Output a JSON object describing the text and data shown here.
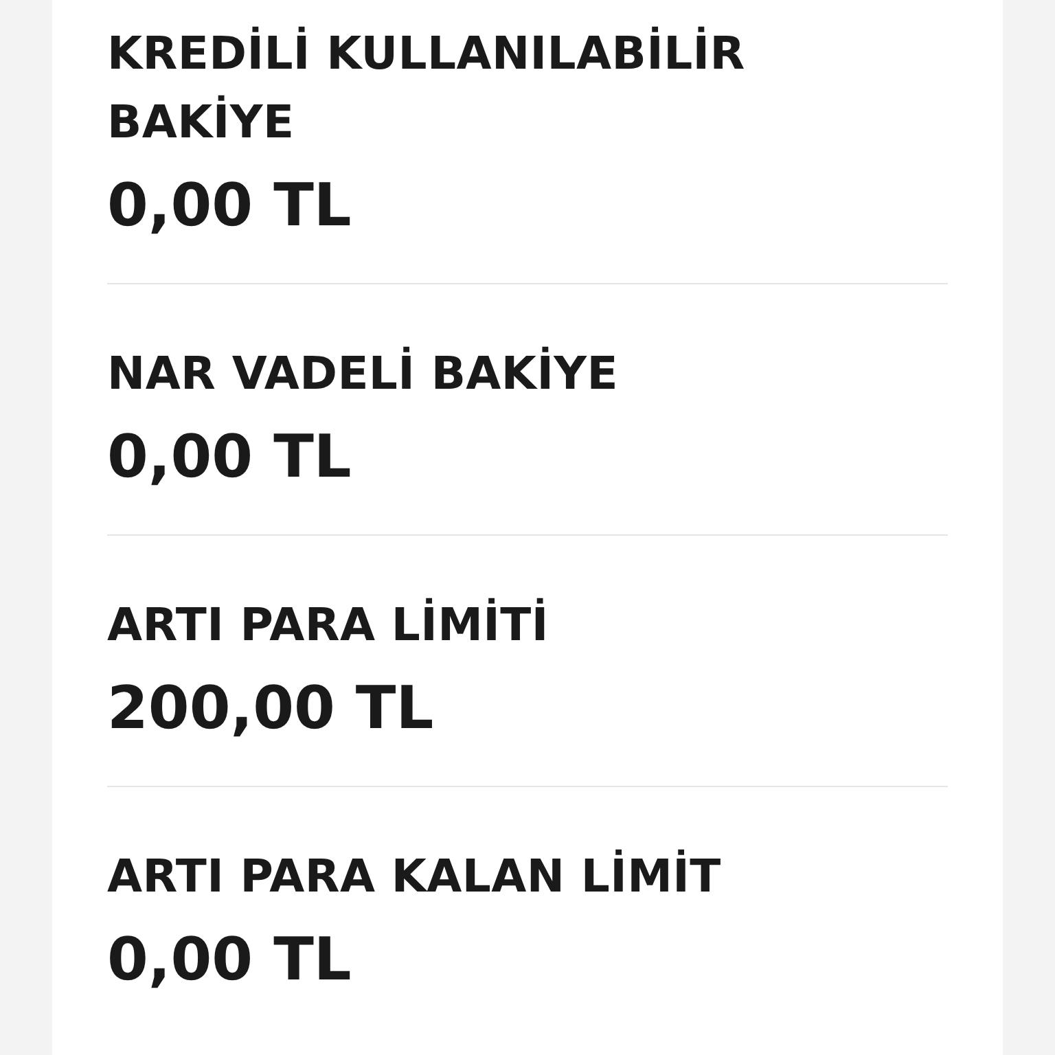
{
  "balances": [
    {
      "label": "KREDİLİ KULLANILABİLİR BAKİYE",
      "value": "0,00 TL"
    },
    {
      "label": "NAR VADELİ BAKİYE",
      "value": "0,00 TL"
    },
    {
      "label": "ARTI PARA LİMİTİ",
      "value": "200,00 TL"
    },
    {
      "label": "ARTI PARA KALAN LİMİT",
      "value": "0,00 TL"
    }
  ]
}
